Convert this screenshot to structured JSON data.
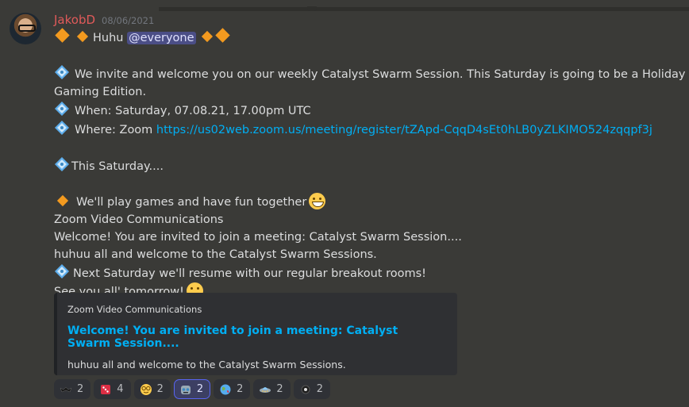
{
  "message": {
    "username": "JakobD",
    "timestamp": "08/06/2021",
    "line_huhu": "Huhu",
    "mention": "@everyone",
    "invite_line1": "We invite and welcome you on our weekly Catalyst Swarm Session. This Saturday is going to be a Holiday",
    "invite_line2": "Gaming Edition.",
    "when": "When: Saturday, 07.08.21, 17.00pm UTC",
    "where_label": "Where: Zoom ",
    "zoom_link": "https://us02web.zoom.us/meeting/register/tZApd-CqqD4sEt0hLB0yZLKIMO524zqqpf3j",
    "this_saturday": "This Saturday....",
    "play_games": "We'll play games and have fun together",
    "zoom_company": "Zoom Video Communications",
    "welcome_line": "Welcome! You are invited to join a meeting: Catalyst Swarm Session....",
    "huhuu_line": "huhuu all and welcome to the Catalyst Swarm Sessions.",
    "next_saturday": "Next Saturday we'll resume with our regular breakout rooms!",
    "see_you": "See you all' tomorrow!"
  },
  "embed": {
    "provider": "Zoom Video Communications",
    "title": "Welcome! You are invited to join a meeting: Catalyst Swarm Session....",
    "description": "huhuu all and welcome to the Catalyst Swarm Sessions."
  },
  "reactions": [
    {
      "icon": "dark-bat-emoji",
      "count": "2"
    },
    {
      "icon": "red-dice-emoji",
      "count": "4"
    },
    {
      "icon": "nerd-face-emoji",
      "count": "2"
    },
    {
      "icon": "robot-face-emoji",
      "count": "2",
      "active": true
    },
    {
      "icon": "globe-emoji",
      "count": "2"
    },
    {
      "icon": "ufo-emoji",
      "count": "2"
    },
    {
      "icon": "dark-circle-emoji",
      "count": "2"
    }
  ],
  "colors": {
    "background": "#3a3a37",
    "username": "#e05a5a",
    "link": "#00aff4",
    "mention_bg": "#4b4e86",
    "diamond": "#f39a1f",
    "gem": "#5dadec"
  }
}
